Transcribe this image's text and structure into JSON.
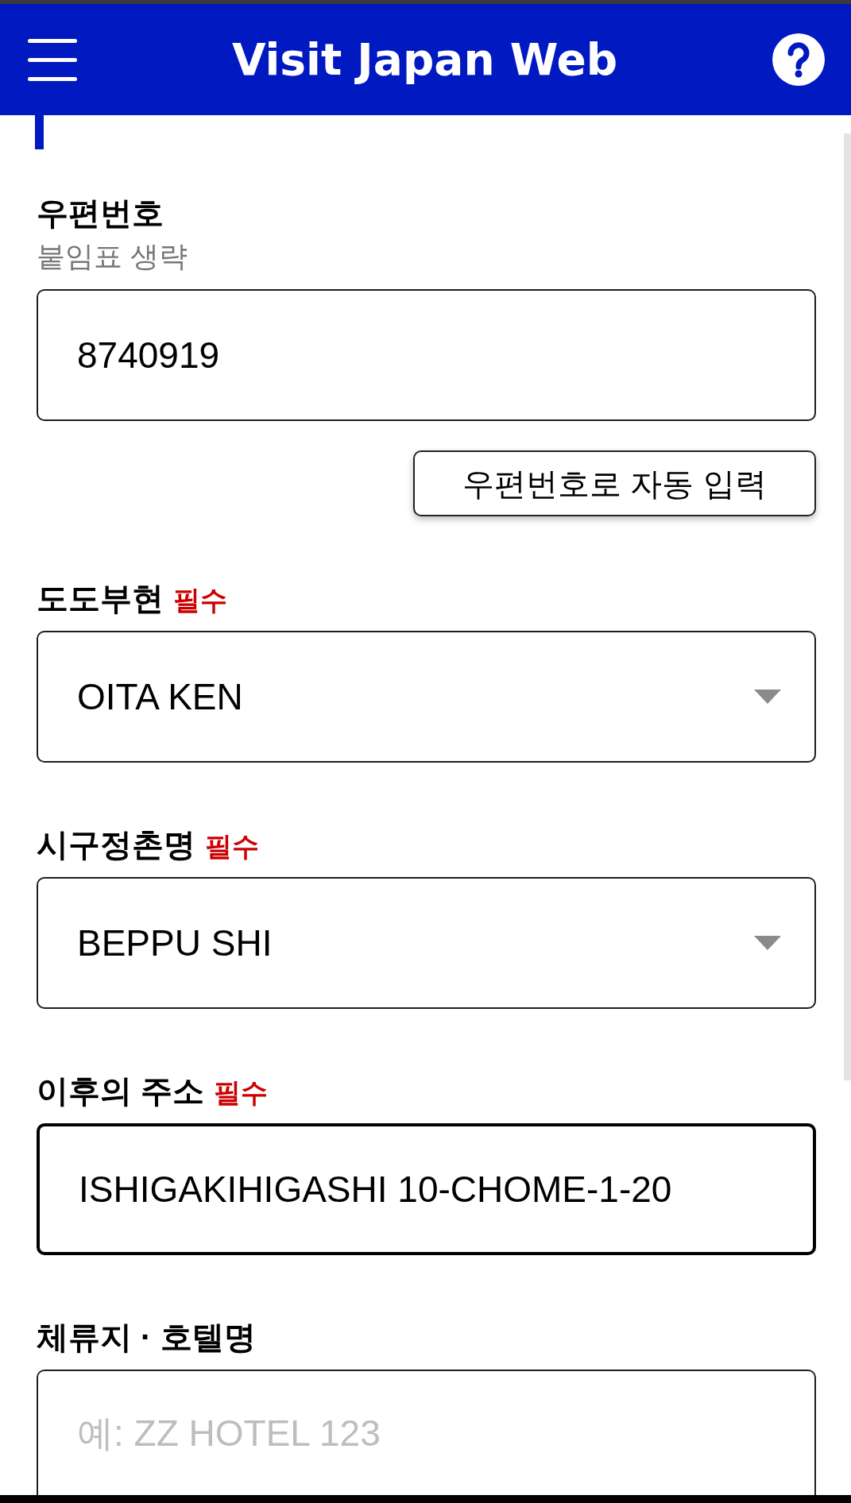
{
  "header": {
    "title": "Visit Japan Web"
  },
  "form": {
    "fields": [
      {
        "kind": "text",
        "label": "우편번호",
        "note": "붙임표 생략",
        "value": "8740919",
        "focused": false,
        "action_button": "우편번호로 자동 입력"
      },
      {
        "kind": "select",
        "label": "도도부현",
        "required_badge": "필수",
        "value": "OITA KEN",
        "focused": false
      },
      {
        "kind": "select",
        "label": "시구정촌명",
        "required_badge": "필수",
        "value": "BEPPU SHI",
        "focused": false
      },
      {
        "kind": "text",
        "label": "이후의 주소",
        "required_badge": "필수",
        "value": "ISHIGAKIHIGASHI 10-CHOME-1-20",
        "focused": true
      },
      {
        "kind": "text",
        "label": "체류지 · 호텔명",
        "placeholder": "예: ZZ HOTEL 123",
        "focused": false
      }
    ]
  }
}
